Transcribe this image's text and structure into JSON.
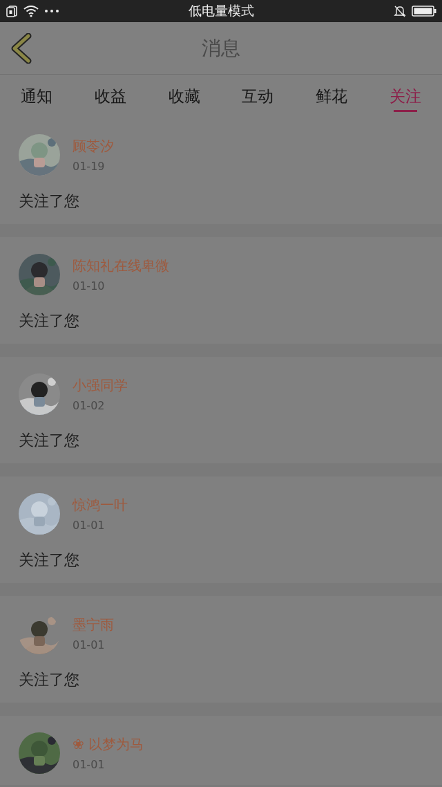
{
  "status_bar": {
    "title": "低电量模式"
  },
  "header": {
    "title": "消息"
  },
  "tabs": [
    {
      "label": "通知",
      "selected": false
    },
    {
      "label": "收益",
      "selected": false
    },
    {
      "label": "收藏",
      "selected": false
    },
    {
      "label": "互动",
      "selected": false
    },
    {
      "label": "鲜花",
      "selected": false
    },
    {
      "label": "关注",
      "selected": true
    }
  ],
  "messages": [
    {
      "name": "顾苓汐",
      "date": "01-19",
      "text": "关注了您"
    },
    {
      "name": "陈知礼在线卑微",
      "date": "01-10",
      "text": "关注了您"
    },
    {
      "name": "小强同学",
      "date": "01-02",
      "text": "关注了您"
    },
    {
      "name": "惊鸿一叶",
      "date": "01-01",
      "text": "关注了您"
    },
    {
      "name": "墨宁雨",
      "date": "01-01",
      "text": "关注了您"
    },
    {
      "name": "❀ 以梦为马",
      "date": "01-01"
    }
  ]
}
